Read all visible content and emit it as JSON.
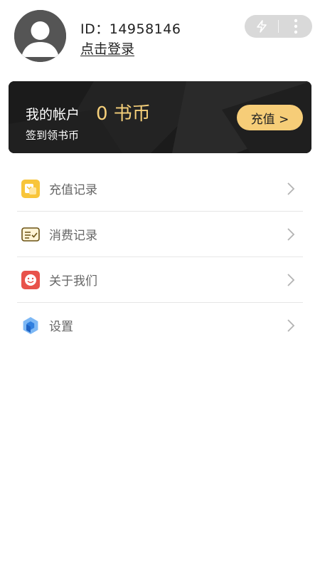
{
  "profile": {
    "user_id_text": "ID：14958146",
    "login_link": "点击登录",
    "avatar_icon": "user-avatar-icon"
  },
  "capsule": {
    "left_icon": "flash-icon",
    "right_icon": "more-vertical-icon"
  },
  "account_card": {
    "label": "我的帐户",
    "balance": "0 书币",
    "subtext": "签到领书币",
    "recharge_button": "充值 >",
    "accent_color": "#f6cd78"
  },
  "menu": {
    "items": [
      {
        "label": "充值记录",
        "icon": "recharge-record-icon",
        "icon_color": "#f8c53a"
      },
      {
        "label": "消费记录",
        "icon": "consume-record-icon",
        "icon_color": "#8a6a1f"
      },
      {
        "label": "关于我们",
        "icon": "about-us-icon",
        "icon_color": "#e8524a"
      },
      {
        "label": "设置",
        "icon": "settings-icon",
        "icon_color": "#3a8ee6"
      }
    ]
  }
}
